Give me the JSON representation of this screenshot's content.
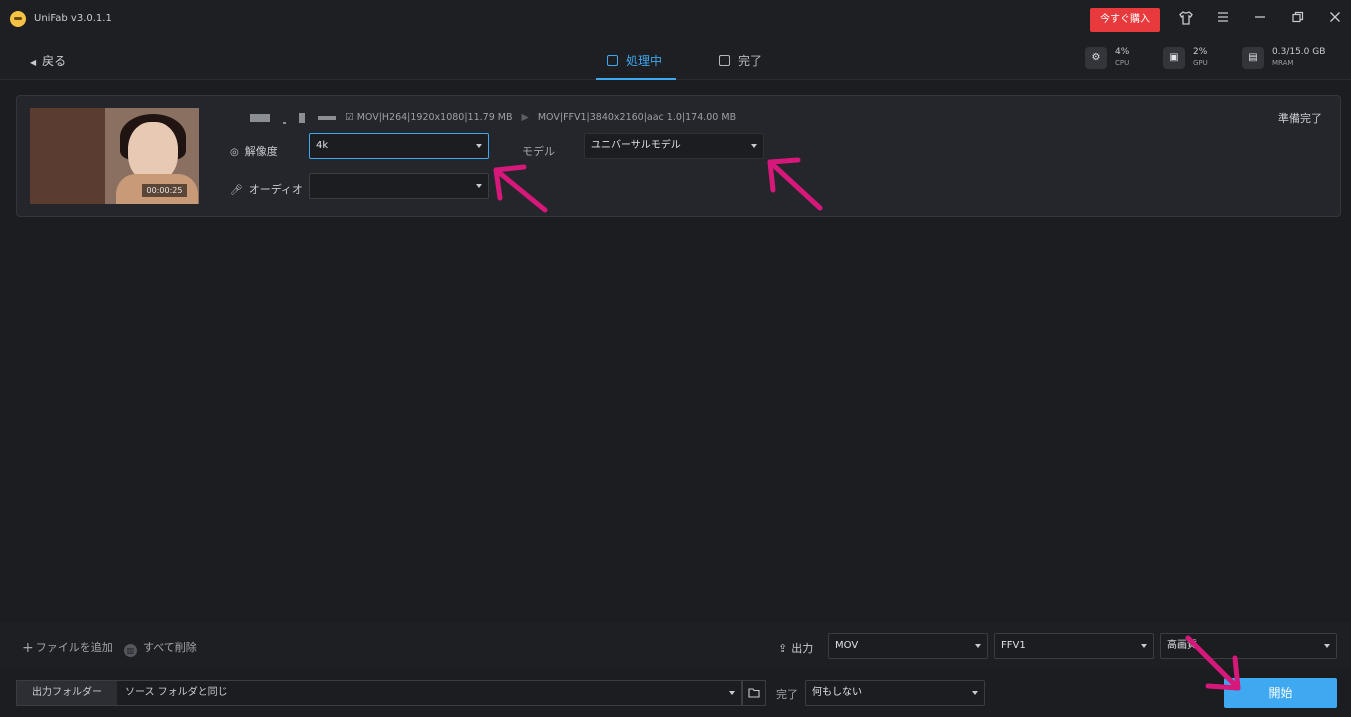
{
  "app": {
    "title": "UniFab v3.0.1.1",
    "buy_label": "今すぐ購入"
  },
  "window_icons": [
    "shirt-icon",
    "menu-icon",
    "minimize-icon",
    "restore-icon",
    "close-icon"
  ],
  "nav": {
    "back_label": "戻る",
    "tabs": [
      {
        "label": "処理中",
        "active": true
      },
      {
        "label": "完了",
        "active": false
      }
    ]
  },
  "stats": {
    "cpu": {
      "value": "4%",
      "label": "CPU"
    },
    "gpu": {
      "value": "2%",
      "label": "GPU"
    },
    "mram": {
      "value": "0.3/15.0 GB",
      "label": "MRAM"
    }
  },
  "task": {
    "thumbnail_time": "00:00:25",
    "source_info": "MOV|H264|1920x1080|11.79 MB",
    "target_info": "MOV|FFV1|3840x2160|aac 1.0|174.00 MB",
    "status": "準備完了",
    "resolution": {
      "label": "解像度",
      "value": "4k"
    },
    "audio": {
      "label": "オーディオ",
      "value": ""
    },
    "model": {
      "label": "モデル",
      "value": "ユニバーサルモデル"
    }
  },
  "toolbar": {
    "add_file_label": "ファイルを追加",
    "delete_all_label": "すべて削除",
    "output_label": "出力",
    "format": "MOV",
    "codec": "FFV1",
    "quality": "高画質"
  },
  "footer": {
    "output_folder_label": "出力フォルダー",
    "output_folder_value": "ソース フォルダと同じ",
    "complete_label": "完了",
    "complete_action": "何もしない",
    "start_label": "開始"
  },
  "colors": {
    "accent": "#3ea8f1",
    "buy_red": "#e8393c",
    "annotation_arrow": "#d6187a",
    "background": "#1c1d21"
  }
}
